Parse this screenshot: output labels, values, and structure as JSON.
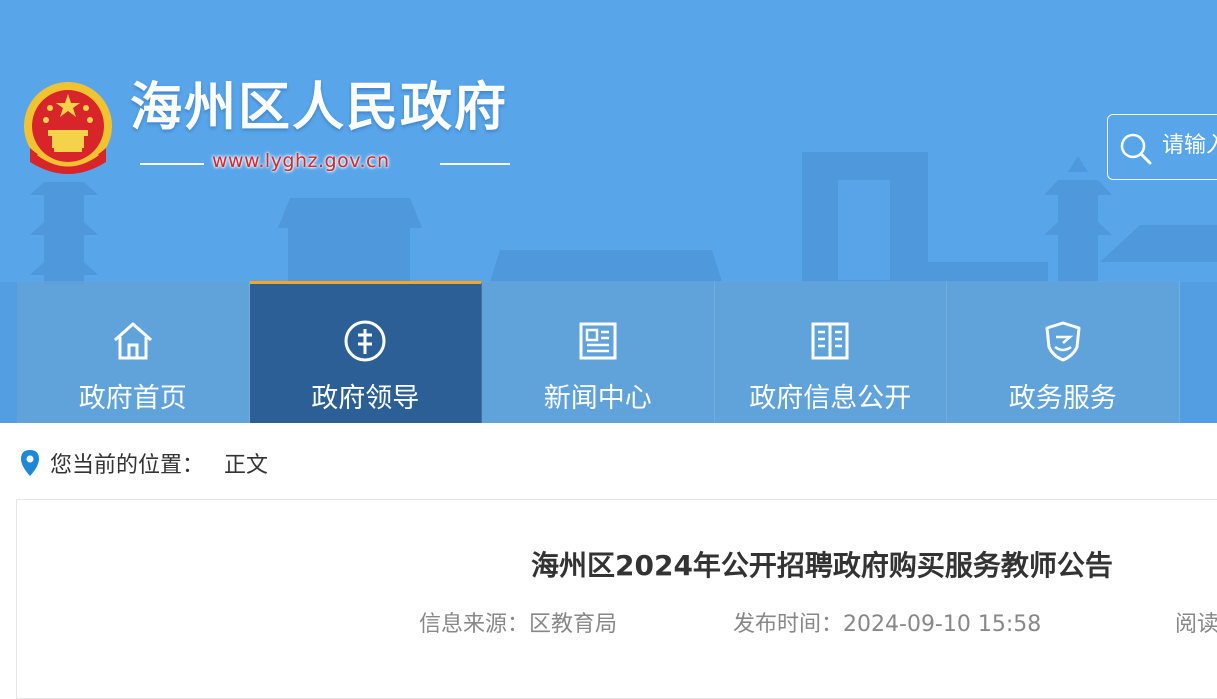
{
  "site": {
    "title": "海州区人民政府",
    "url": "www.lyghz.gov.cn"
  },
  "search": {
    "placeholder": "请输入"
  },
  "nav": {
    "items": [
      {
        "label": "政府首页",
        "icon": "home-icon",
        "active": false
      },
      {
        "label": "政府领导",
        "icon": "leader-icon",
        "active": true
      },
      {
        "label": "新闻中心",
        "icon": "news-icon",
        "active": false
      },
      {
        "label": "政府信息公开",
        "icon": "book-icon",
        "active": false
      },
      {
        "label": "政务服务",
        "icon": "shield-icon",
        "active": false
      }
    ]
  },
  "breadcrumb": {
    "prefix": "您当前的位置：",
    "current": "正文"
  },
  "article": {
    "title": "海州区2024年公开招聘政府购买服务教师公告",
    "source_label": "信息来源：",
    "source_value": "区教育局",
    "time_label": "发布时间：",
    "time_value": "2024-09-10 15:58",
    "read_label": "阅读"
  },
  "colors": {
    "banner": "#58a5ea",
    "nav_active": "#2c5f95",
    "nav_active_border": "#f5a623",
    "url_text": "#d6262b"
  }
}
